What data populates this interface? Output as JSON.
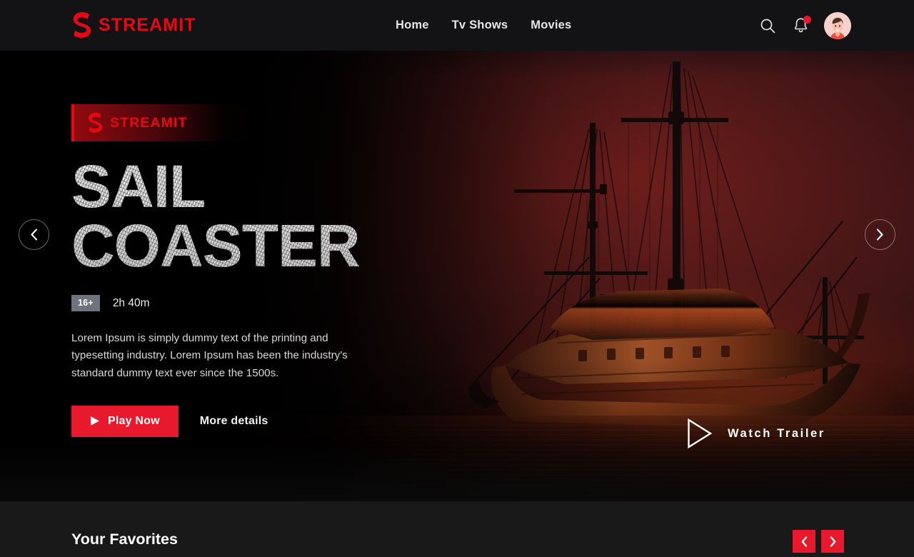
{
  "header": {
    "brand": {
      "name": "STREAMIT",
      "mark_icon": "streamit-s-logo-icon",
      "color": "#e50914"
    },
    "nav": [
      {
        "label": "Home",
        "name": "home"
      },
      {
        "label": "Tv Shows",
        "name": "tv-shows"
      },
      {
        "label": "Movies",
        "name": "movies"
      }
    ],
    "actions": {
      "search_icon": "search-icon",
      "notifications_icon": "bell-icon",
      "notification_dot": true,
      "avatar_icon": "user-avatar"
    }
  },
  "hero": {
    "badge": {
      "mark_icon": "streamit-s-logo-icon",
      "label": "STREAMIT"
    },
    "title_line1": "SAIL",
    "title_line2": "COASTER",
    "rating": "16+",
    "duration": "2h 40m",
    "description": "Lorem Ipsum is simply dummy text of the printing and typesetting industry. Lorem Ipsum has been the industry's standard dummy text ever since the 1500s.",
    "play_label": "Play Now",
    "play_icon": "play-triangle-icon",
    "more_label": "More details",
    "trailer_label": "Watch Trailer",
    "trailer_icon": "play-outline-icon",
    "prev_icon": "chevron-left-icon",
    "next_icon": "chevron-right-icon",
    "background_alt": "tall sailing ship at dusk with red sky"
  },
  "favorites": {
    "title": "Your Favorites",
    "prev_icon": "chevron-left-icon",
    "next_icon": "chevron-right-icon"
  },
  "colors": {
    "accent": "#e50914",
    "accent_button": "#e8192c",
    "header_bg": "#131316",
    "section_bg": "#191919",
    "rating_bg": "#6e737d"
  }
}
